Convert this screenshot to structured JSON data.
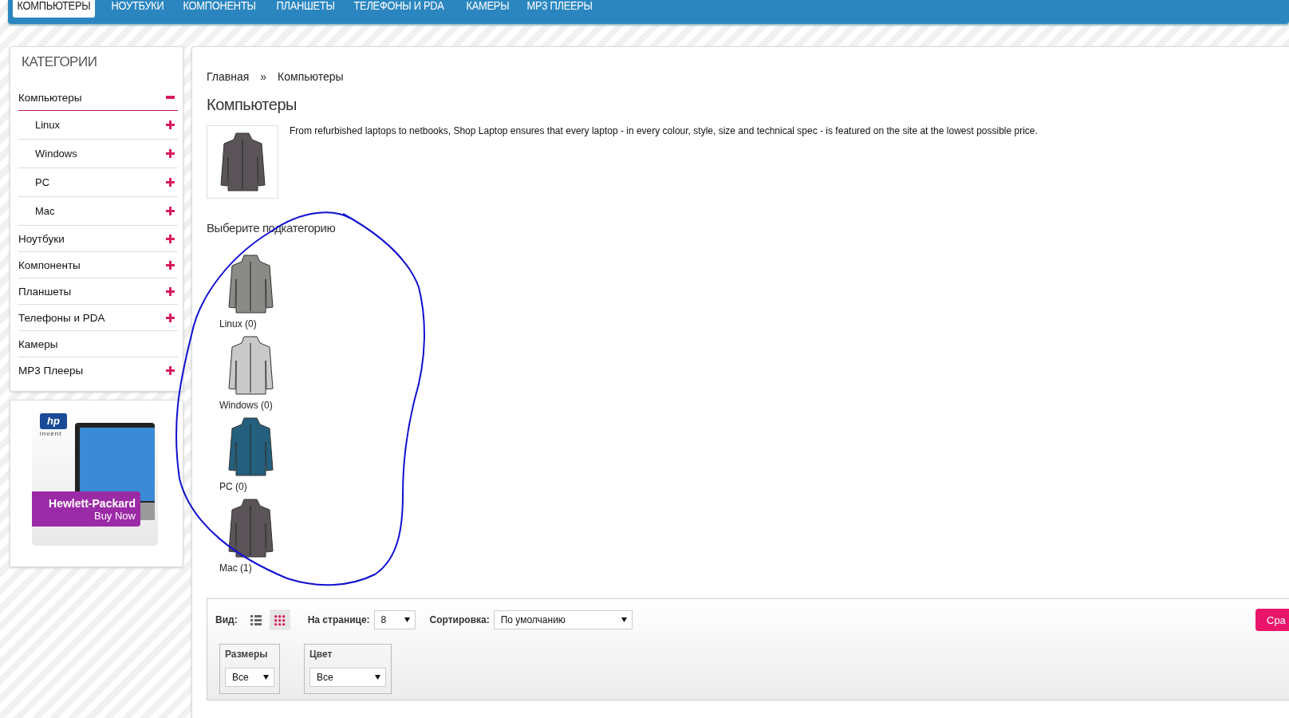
{
  "nav": {
    "tabs": [
      {
        "label": "КОМПЬЮТЕРЫ",
        "selected": true
      },
      {
        "label": "НОУТБУКИ",
        "selected": false
      },
      {
        "label": "КОМПОНЕНТЫ",
        "selected": false
      },
      {
        "label": "ПЛАНШЕТЫ",
        "selected": false
      },
      {
        "label": "ТЕЛЕФОНЫ И PDA",
        "selected": false
      },
      {
        "label": "КАМЕРЫ",
        "selected": false
      },
      {
        "label": "MP3 ПЛЕЕРЫ",
        "selected": false
      }
    ]
  },
  "sidebar": {
    "title": "КАТЕГОРИИ",
    "items": [
      {
        "label": "Компьютеры",
        "expandable": true,
        "expanded": true,
        "children": [
          {
            "label": "Linux",
            "expandable": true,
            "expanded": false
          },
          {
            "label": "Windows",
            "expandable": true,
            "expanded": false
          },
          {
            "label": "PC",
            "expandable": true,
            "expanded": false
          },
          {
            "label": "Mac",
            "expandable": true,
            "expanded": false
          }
        ]
      },
      {
        "label": "Ноутбуки",
        "expandable": true,
        "expanded": false
      },
      {
        "label": "Компоненты",
        "expandable": true,
        "expanded": false
      },
      {
        "label": "Планшеты",
        "expandable": true,
        "expanded": false
      },
      {
        "label": "Телефоны и PDA",
        "expandable": true,
        "expanded": false
      },
      {
        "label": "Камеры",
        "expandable": false
      },
      {
        "label": "MP3 Плееры",
        "expandable": true,
        "expanded": false
      }
    ],
    "banner": {
      "logo": "hp",
      "logo_tagline": "invent",
      "title": "Hewlett-Packard",
      "cta": "Buy Now"
    }
  },
  "breadcrumb": [
    "Главная",
    "»",
    "Компьютеры"
  ],
  "category": {
    "title": "Компьютеры",
    "description": "From refurbished laptops to netbooks, Shop Laptop ensures that every laptop - in every colour, style, size and technical spec - is featured on the site at the lowest possible price."
  },
  "subcategories": {
    "heading": "Выберите подкатегорию",
    "items": [
      {
        "label": "Linux (0)"
      },
      {
        "label": "Windows (0)"
      },
      {
        "label": "PC (0)"
      },
      {
        "label": "Mac (1)"
      }
    ]
  },
  "toolbar": {
    "view_label": "Вид:",
    "views": [
      {
        "kind": "list",
        "selected": false
      },
      {
        "kind": "grid",
        "selected": true
      }
    ],
    "per_page_label": "На странице:",
    "per_page": "8",
    "sort_label": "Сортировка:",
    "sort": "По умолчанию",
    "compare_button": "Сра",
    "filters": [
      {
        "label": "Размеры",
        "value": "Все"
      },
      {
        "label": "Цвет",
        "value": "Все"
      }
    ]
  }
}
